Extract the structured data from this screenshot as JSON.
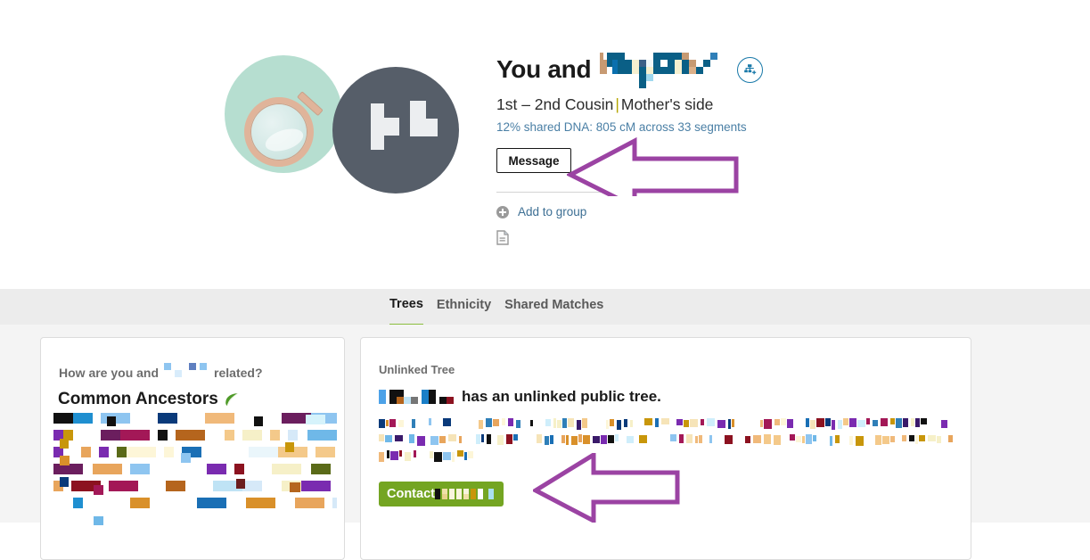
{
  "header": {
    "title_prefix": "You and",
    "redacted_name_label": "redacted-name",
    "relationship": "1st – 2nd Cousin",
    "relationship_separator": "|",
    "relationship_side": "Mother's side",
    "dna_stats": "12% shared DNA: 805 cM across 33 segments",
    "message_label": "Message",
    "add_to_group_label": "Add to group",
    "tree_icon_name": "add-to-tree-icon",
    "note_icon_name": "note-icon",
    "avatar_you_icon": "magnifying-glass-icon",
    "avatar_match_initials_label": "redacted-initials"
  },
  "tabs": [
    {
      "label": "Trees",
      "active": true
    },
    {
      "label": "Ethnicity",
      "active": false
    },
    {
      "label": "Shared Matches",
      "active": false
    }
  ],
  "left_card": {
    "question_prefix": "How are you and",
    "question_suffix": "related?",
    "heading": "Common Ancestors",
    "leaf_icon": "leaf-icon"
  },
  "right_card": {
    "section_label": "Unlinked Tree",
    "sentence": "has an unlinked public tree.",
    "contact_label": "Contact",
    "contact_redacted_label": "redacted-name"
  },
  "annotations": [
    {
      "name": "arrow-pointing-to-message-button",
      "color": "#9b43a3",
      "direction": "left"
    },
    {
      "name": "arrow-pointing-to-contact-button",
      "color": "#9b43a3",
      "direction": "left"
    }
  ],
  "colors": {
    "accent_green": "#8cbe3f",
    "contact_green": "#74a522",
    "link_blue": "#3d6f94",
    "dna_blue": "#4a7fa5",
    "avatar_mint": "#b6ded0",
    "avatar_slate": "#565e69",
    "annotation_purple": "#9b43a3",
    "tab_bar_bg": "#ececec",
    "content_bg": "#f4f4f4"
  },
  "redactions": {
    "header_name": [
      [
        [
          6,
          0,
          "#c79a72"
        ],
        [
          10,
          0,
          "#ffffff"
        ],
        [
          14,
          0,
          "#0a5f86"
        ],
        [
          20,
          0,
          "#0a5f86"
        ],
        [
          26,
          0,
          "#0a5f86"
        ],
        [
          34,
          0,
          "#ffffff"
        ],
        [
          42,
          0,
          "#ffffff"
        ],
        [
          50,
          0,
          "#ffffff"
        ],
        [
          58,
          0,
          "#ffffff"
        ],
        [
          66,
          0,
          "#0a5f86"
        ],
        [
          74,
          0,
          "#0a5f86"
        ],
        [
          82,
          0,
          "#0a5f86"
        ],
        [
          90,
          0,
          "#0a5f86"
        ],
        [
          98,
          0,
          "#c79a72"
        ],
        [
          106,
          0,
          "#ffffff"
        ],
        [
          114,
          0,
          "#ffffff"
        ],
        [
          122,
          0,
          "#ffffff"
        ],
        [
          130,
          0,
          "#2f7fb8"
        ]
      ],
      [
        [
          6,
          8,
          "#c79a72"
        ],
        [
          14,
          8,
          "#0a5f86"
        ],
        [
          20,
          8,
          "#0a6fae"
        ],
        [
          26,
          8,
          "#0a5f86"
        ],
        [
          34,
          8,
          "#0a5f86"
        ],
        [
          42,
          8,
          "#f6f0d0"
        ],
        [
          50,
          8,
          "#3b5f86"
        ],
        [
          58,
          8,
          "#eef6f8"
        ],
        [
          66,
          8,
          "#0a5f86"
        ],
        [
          74,
          8,
          "#ffffff"
        ],
        [
          82,
          8,
          "#0a5f86"
        ],
        [
          90,
          8,
          "#f6f0d0"
        ],
        [
          98,
          8,
          "#0a5f86"
        ],
        [
          106,
          8,
          "#c79a72"
        ],
        [
          114,
          8,
          "#ffffff"
        ],
        [
          122,
          8,
          "#0a5f86"
        ],
        [
          130,
          8,
          "#ffffff"
        ]
      ],
      [
        [
          6,
          16,
          "#c79a72"
        ],
        [
          14,
          16,
          "#ffffff"
        ],
        [
          20,
          16,
          "#0a6fae"
        ],
        [
          26,
          16,
          "#0a5f86"
        ],
        [
          34,
          16,
          "#0a5f86"
        ],
        [
          42,
          16,
          "#f6f0d0"
        ],
        [
          50,
          16,
          "#0a5f86"
        ],
        [
          58,
          16,
          "#f6f0d0"
        ],
        [
          66,
          16,
          "#0a5f86"
        ],
        [
          74,
          16,
          "#0a5f86"
        ],
        [
          82,
          16,
          "#0a5f86"
        ],
        [
          90,
          16,
          "#f6f0d0"
        ],
        [
          98,
          16,
          "#0a5f86"
        ],
        [
          106,
          16,
          "#dcb089"
        ],
        [
          114,
          16,
          "#0a5f86"
        ],
        [
          122,
          16,
          "#ffffff"
        ],
        [
          130,
          16,
          "#ffffff"
        ]
      ],
      [
        [
          50,
          24,
          "#0a5f86"
        ],
        [
          58,
          24,
          "#9fd8ef"
        ],
        [
          66,
          24,
          "#ffffff"
        ]
      ],
      [
        [
          50,
          32,
          "#0a5f86"
        ]
      ]
    ],
    "avatar_initials": [
      [
        [
          0,
          0,
          1,
          3
        ],
        [
          1,
          1,
          2,
          1
        ]
      ],
      [
        [
          4,
          0,
          1,
          2
        ],
        [
          4,
          1,
          3,
          1
        ]
      ]
    ],
    "left_question_name": [
      [
        [
          0,
          0,
          "#8ec5f0"
        ],
        [
          20,
          0,
          "#ffffff"
        ],
        [
          28,
          0,
          "#5f7fc0"
        ],
        [
          40,
          0,
          "#8ec5f0"
        ]
      ],
      [
        [
          0,
          8,
          "#ffffff"
        ],
        [
          12,
          8,
          "#d8ecfb"
        ],
        [
          28,
          8,
          "#ffffff"
        ],
        [
          40,
          8,
          "#ffffff"
        ]
      ]
    ],
    "tree_sentence_name": [
      [
        [
          0,
          0,
          "#4da2e8"
        ],
        [
          12,
          0,
          "#111111"
        ],
        [
          20,
          0,
          "#111111"
        ],
        [
          28,
          0,
          "#ffffff"
        ],
        [
          36,
          0,
          "#ffffff"
        ],
        [
          48,
          0,
          "#1a7fc8"
        ],
        [
          56,
          0,
          "#111111"
        ],
        [
          68,
          0,
          "#ffffff"
        ],
        [
          76,
          0,
          "#ffffff"
        ]
      ],
      [
        [
          0,
          8,
          "#4da2e8"
        ],
        [
          12,
          8,
          "#111111"
        ],
        [
          20,
          8,
          "#b5651d"
        ],
        [
          28,
          8,
          "#bfe3f5"
        ],
        [
          36,
          8,
          "#767676"
        ],
        [
          48,
          8,
          "#1a7fc8"
        ],
        [
          56,
          8,
          "#111111"
        ],
        [
          68,
          8,
          "#111111"
        ],
        [
          76,
          8,
          "#8c1220"
        ]
      ]
    ],
    "contact_name": [
      [
        [
          0,
          0,
          "#111111"
        ],
        [
          8,
          0,
          "#f0e0a8"
        ],
        [
          16,
          0,
          "#f8f4dc"
        ],
        [
          24,
          0,
          "#f8f4dc"
        ],
        [
          32,
          0,
          "#f8f4dc"
        ],
        [
          40,
          0,
          "#c8960a"
        ],
        [
          48,
          0,
          "#ffffff"
        ],
        [
          60,
          0,
          "#aadff0"
        ]
      ],
      [
        [
          0,
          6,
          "#111111"
        ],
        [
          8,
          6,
          "#e8d28c"
        ],
        [
          16,
          6,
          "#f8f4dc"
        ],
        [
          24,
          6,
          "#f8f4dc"
        ],
        [
          32,
          6,
          "#f0e0a8"
        ],
        [
          40,
          6,
          "#c8960a"
        ],
        [
          48,
          6,
          "#ffffff"
        ],
        [
          60,
          6,
          "#aadff0"
        ]
      ]
    ]
  }
}
